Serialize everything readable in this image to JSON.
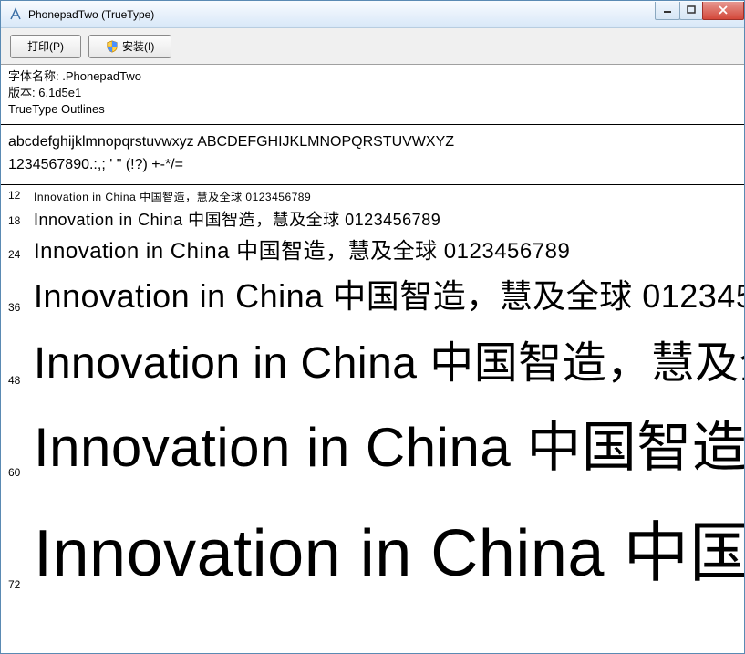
{
  "window": {
    "title": "PhonepadTwo (TrueType)"
  },
  "toolbar": {
    "print_label": "打印(P)",
    "install_label": "安装(I)"
  },
  "info": {
    "font_name_label": "字体名称: ",
    "font_name": ".PhonepadTwo",
    "version_label": "版本: ",
    "version": "6.1d5e1",
    "outlines": "TrueType Outlines"
  },
  "charset": {
    "line1": "abcdefghijklmnopqrstuvwxyz ABCDEFGHIJKLMNOPQRSTUVWXYZ",
    "line2": "1234567890.:,; ' \" (!?) +-*/="
  },
  "samples": {
    "text": "Innovation in China 中国智造，慧及全球 0123456789",
    "sizes": [
      {
        "label": "12",
        "cls": "s12"
      },
      {
        "label": "18",
        "cls": "s18"
      },
      {
        "label": "24",
        "cls": "s24"
      },
      {
        "label": "36",
        "cls": "s36"
      },
      {
        "label": "48",
        "cls": "s48"
      },
      {
        "label": "60",
        "cls": "s60"
      },
      {
        "label": "72",
        "cls": "s72"
      }
    ]
  }
}
